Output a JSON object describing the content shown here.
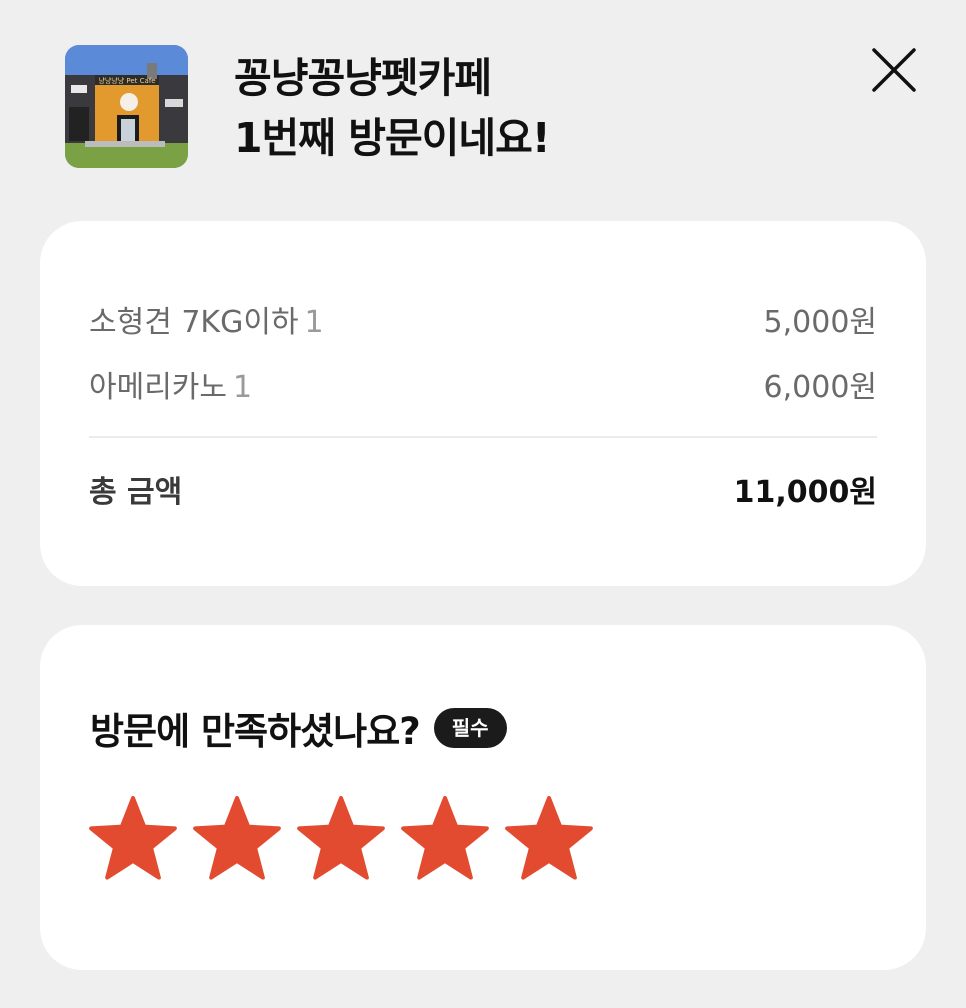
{
  "header": {
    "store_name": "꽁냥꽁냥펫카페",
    "visit_message": "1번째 방문이네요!",
    "thumbnail_sign": "냥냥냥냥 Pet Cafe"
  },
  "order": {
    "items": [
      {
        "name": "소형견 7KG이하",
        "qty": "1",
        "price": "5,000원"
      },
      {
        "name": "아메리카노",
        "qty": "1",
        "price": "6,000원"
      }
    ],
    "total_label": "총 금액",
    "total_value": "11,000원"
  },
  "rating": {
    "question": "방문에 만족하셨나요?",
    "required_label": "필수",
    "stars_selected": 5,
    "stars_total": 5,
    "star_color": "#e24b30"
  },
  "icons": {
    "close": "close-icon",
    "star": "star-icon"
  }
}
